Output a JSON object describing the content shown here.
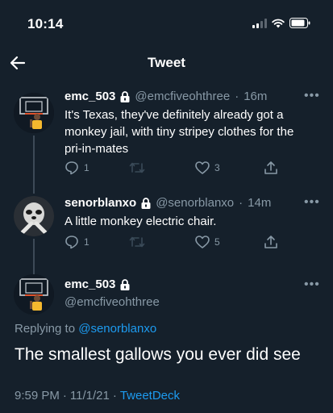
{
  "status_bar": {
    "time": "10:14"
  },
  "header": {
    "title": "Tweet"
  },
  "tweets": [
    {
      "display_name": "emc_503",
      "handle": "@emcfiveohthree",
      "separator": "·",
      "age": "16m",
      "text_lines": [
        "It's Texas, they've definitely already got a",
        "monkey jail, with tiny stripey clothes for the",
        "pri-in-mates"
      ],
      "replies": "1",
      "likes": "3"
    },
    {
      "display_name": "senorblanxo",
      "handle": "@senorblanxo",
      "separator": "·",
      "age": "14m",
      "text_lines": [
        "A little monkey electric chair."
      ],
      "replies": "1",
      "likes": "5"
    }
  ],
  "main_tweet": {
    "display_name": "emc_503",
    "handle": "@emcfiveohthree",
    "replying_prefix": "Replying to",
    "replying_to": "@senorblanxo",
    "text": "The smallest gallows you ever did see",
    "time": "9:59 PM",
    "date": "11/1/21",
    "separator": "·",
    "source": "TweetDeck"
  },
  "colors": {
    "background": "#15202b",
    "muted": "#8899a6",
    "link": "#1d9bf0",
    "jersey": "#f5b82e"
  }
}
